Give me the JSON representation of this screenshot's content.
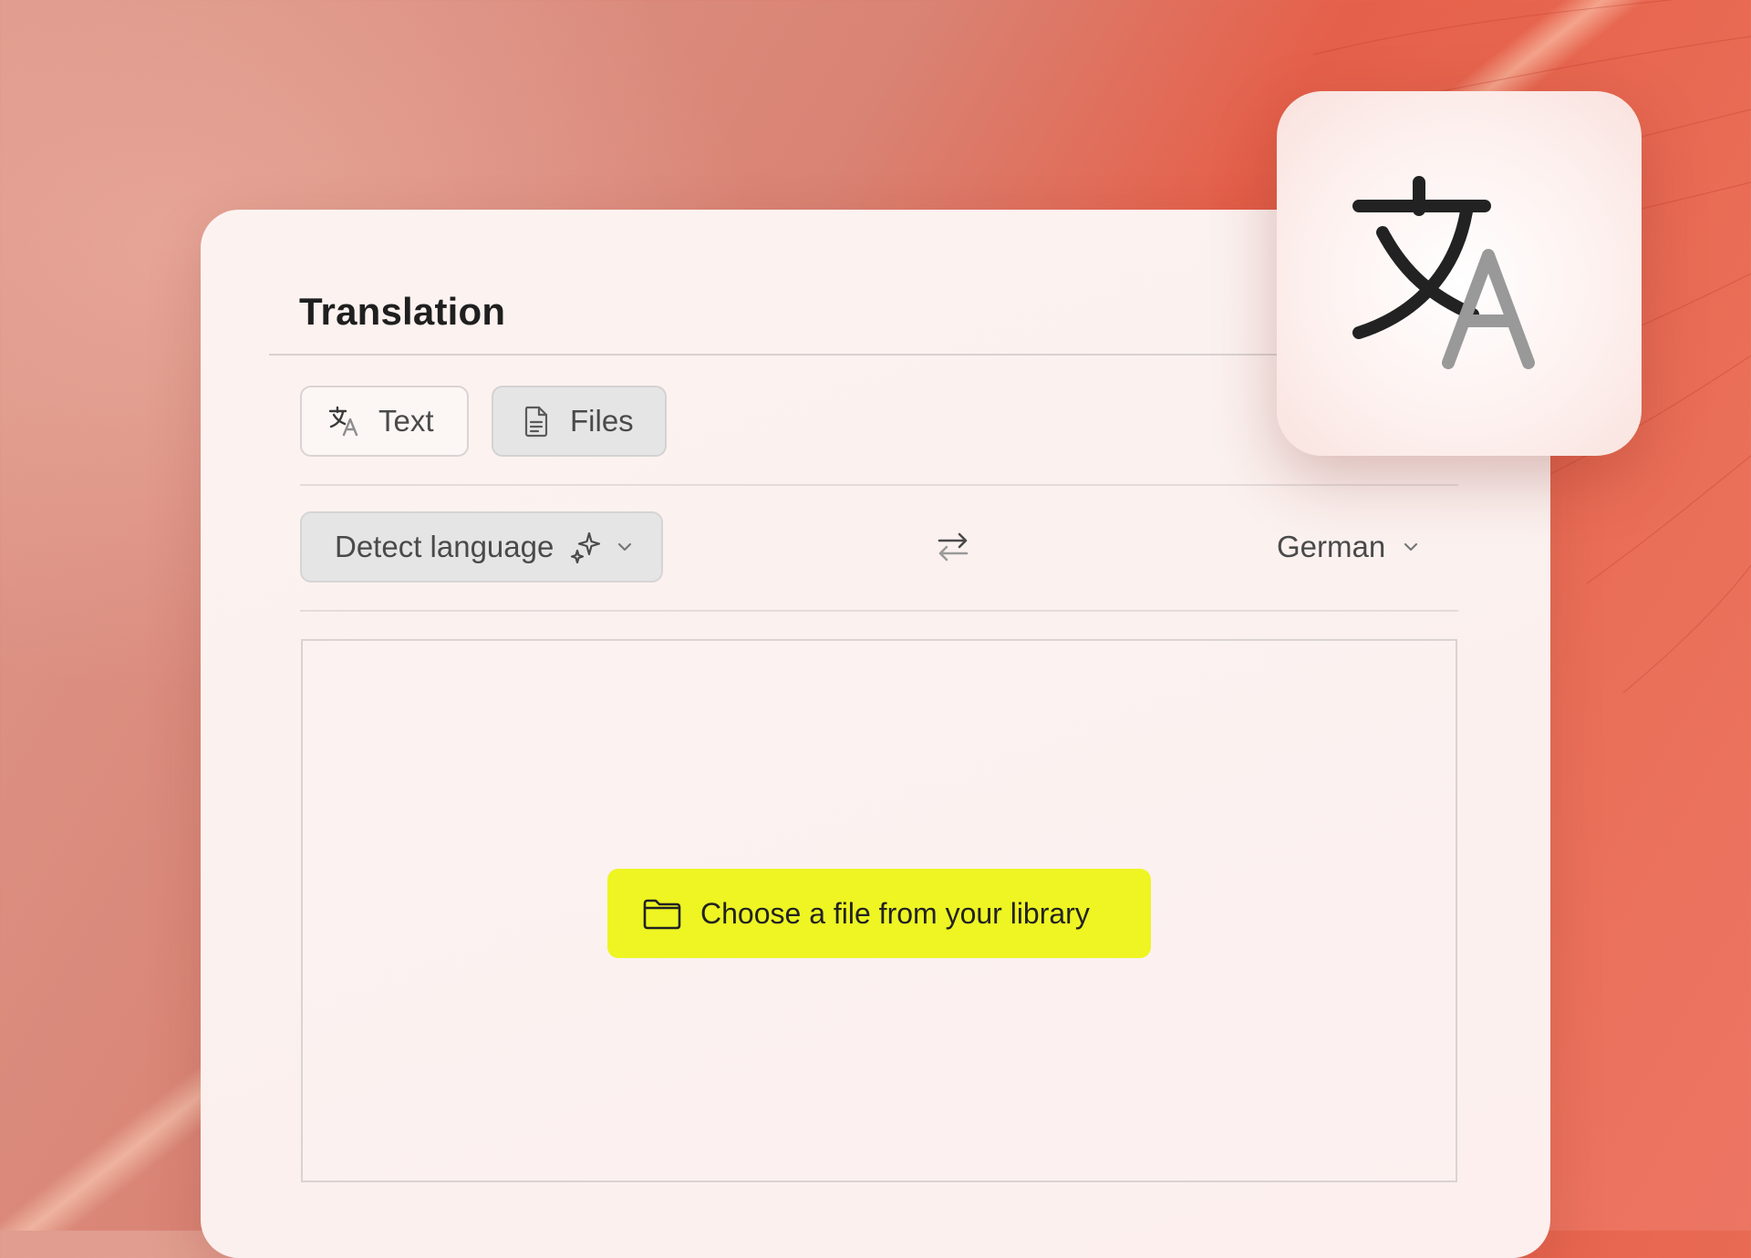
{
  "app": {
    "title": "Translation"
  },
  "tabs": [
    {
      "label": "Text",
      "icon": "translate-icon",
      "selected": false
    },
    {
      "label": "Files",
      "icon": "document-icon",
      "selected": true
    }
  ],
  "source_language": {
    "value": "Detect language",
    "icon": "sparkle-icon"
  },
  "swap": {
    "icon": "swap-arrows-icon"
  },
  "target_language": {
    "value": "German"
  },
  "dropzone": {
    "button_label": "Choose a file from your library",
    "button_icon": "folder-icon"
  },
  "colors": {
    "accent": "#eef523",
    "background": "#e5604a",
    "card": "#fcf3f1"
  }
}
